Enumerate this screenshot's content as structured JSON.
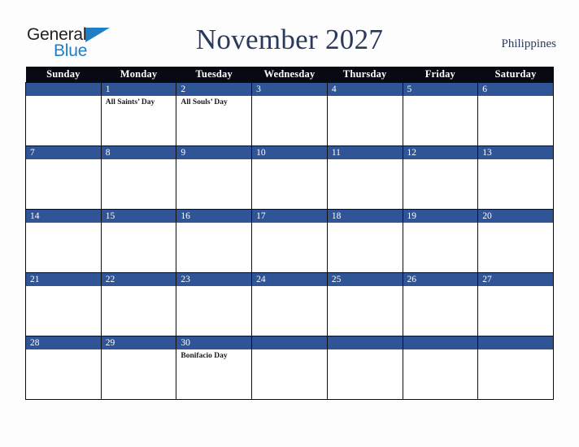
{
  "brand": {
    "name_part1": "General",
    "name_part2": "Blue",
    "triangle_color": "#1f7ec4",
    "text_color": "#231f20"
  },
  "header": {
    "title": "November 2027",
    "country": "Philippines",
    "title_color": "#2b3a5c"
  },
  "calendar": {
    "weekday_headers": [
      "Sunday",
      "Monday",
      "Tuesday",
      "Wednesday",
      "Thursday",
      "Friday",
      "Saturday"
    ],
    "header_bg": "#070a12",
    "day_bar_bg": "#2f5597",
    "grid_border": "#0d0d0d",
    "weeks": [
      [
        {
          "day": "",
          "events": []
        },
        {
          "day": "1",
          "events": [
            "All Saints’ Day"
          ]
        },
        {
          "day": "2",
          "events": [
            "All Souls’ Day"
          ]
        },
        {
          "day": "3",
          "events": []
        },
        {
          "day": "4",
          "events": []
        },
        {
          "day": "5",
          "events": []
        },
        {
          "day": "6",
          "events": []
        }
      ],
      [
        {
          "day": "7",
          "events": []
        },
        {
          "day": "8",
          "events": []
        },
        {
          "day": "9",
          "events": []
        },
        {
          "day": "10",
          "events": []
        },
        {
          "day": "11",
          "events": []
        },
        {
          "day": "12",
          "events": []
        },
        {
          "day": "13",
          "events": []
        }
      ],
      [
        {
          "day": "14",
          "events": []
        },
        {
          "day": "15",
          "events": []
        },
        {
          "day": "16",
          "events": []
        },
        {
          "day": "17",
          "events": []
        },
        {
          "day": "18",
          "events": []
        },
        {
          "day": "19",
          "events": []
        },
        {
          "day": "20",
          "events": []
        }
      ],
      [
        {
          "day": "21",
          "events": []
        },
        {
          "day": "22",
          "events": []
        },
        {
          "day": "23",
          "events": []
        },
        {
          "day": "24",
          "events": []
        },
        {
          "day": "25",
          "events": []
        },
        {
          "day": "26",
          "events": []
        },
        {
          "day": "27",
          "events": []
        }
      ],
      [
        {
          "day": "28",
          "events": []
        },
        {
          "day": "29",
          "events": []
        },
        {
          "day": "30",
          "events": [
            "Bonifacio Day"
          ]
        },
        {
          "day": "",
          "events": []
        },
        {
          "day": "",
          "events": []
        },
        {
          "day": "",
          "events": []
        },
        {
          "day": "",
          "events": []
        }
      ]
    ]
  }
}
